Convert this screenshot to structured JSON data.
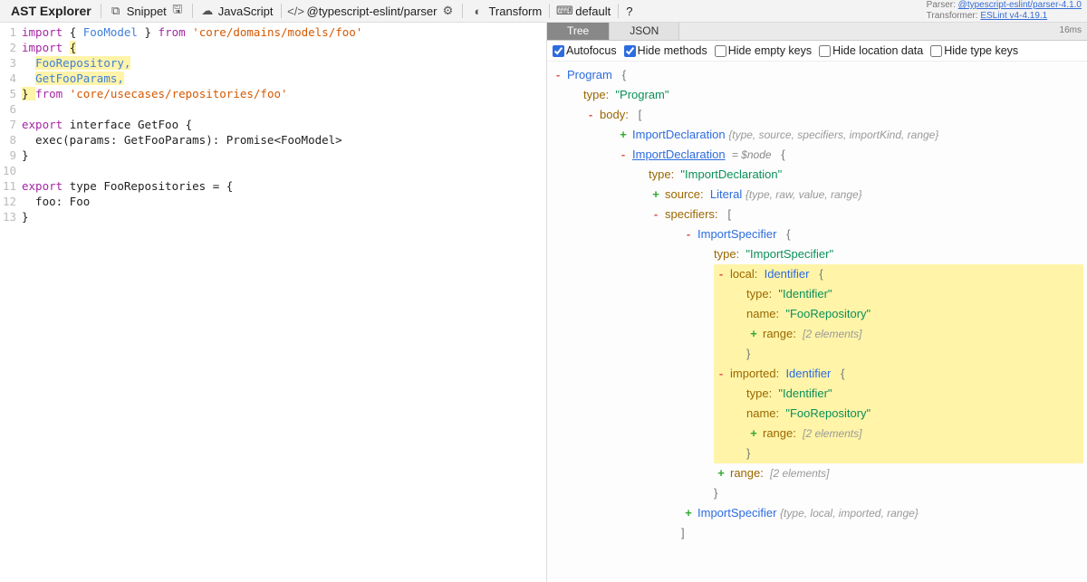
{
  "toolbar": {
    "brand": "AST Explorer",
    "snippet": "Snippet",
    "language": "JavaScript",
    "parser": "@typescript-eslint/parser",
    "transform": "Transform",
    "default": "default",
    "help": "?"
  },
  "parser_info": {
    "parser_label": "Parser:",
    "parser_link": "@typescript-eslint/parser-4.1.0",
    "transformer_label": "Transformer:",
    "transformer_link": "ESLint v4-4.19.1"
  },
  "code_lines": [
    {
      "n": "1",
      "segs": [
        {
          "t": "import ",
          "c": "k-import"
        },
        {
          "t": "{ "
        },
        {
          "t": "FooModel",
          "c": "k-type"
        },
        {
          "t": " } "
        },
        {
          "t": "from ",
          "c": "k-import"
        },
        {
          "t": "'core/domains/models/foo'",
          "c": "k-str"
        }
      ]
    },
    {
      "n": "2",
      "segs": [
        {
          "t": "import ",
          "c": "k-import"
        },
        {
          "t": "{",
          "hl": true
        }
      ]
    },
    {
      "n": "3",
      "segs": [
        {
          "t": "  "
        },
        {
          "t": "FooRepository,",
          "c": "k-type",
          "hl": true
        }
      ]
    },
    {
      "n": "4",
      "segs": [
        {
          "t": "  "
        },
        {
          "t": "GetFooParams,",
          "c": "k-type",
          "hl": true
        }
      ]
    },
    {
      "n": "5",
      "segs": [
        {
          "t": "} ",
          "hl": true
        },
        {
          "t": "from ",
          "c": "k-import"
        },
        {
          "t": "'core/usecases/repositories/foo'",
          "c": "k-str"
        }
      ]
    },
    {
      "n": "6",
      "segs": [
        {
          "t": ""
        }
      ]
    },
    {
      "n": "7",
      "segs": [
        {
          "t": "export ",
          "c": "k-export"
        },
        {
          "t": "interface ",
          "c": ""
        },
        {
          "t": "GetFoo "
        },
        {
          "t": "{"
        }
      ]
    },
    {
      "n": "8",
      "segs": [
        {
          "t": "  exec(params: GetFooParams): Promise<FooModel>"
        }
      ]
    },
    {
      "n": "9",
      "segs": [
        {
          "t": "}"
        }
      ]
    },
    {
      "n": "10",
      "segs": [
        {
          "t": ""
        }
      ]
    },
    {
      "n": "11",
      "segs": [
        {
          "t": "export ",
          "c": "k-export"
        },
        {
          "t": "type ",
          "c": ""
        },
        {
          "t": "FooRepositories = {"
        }
      ]
    },
    {
      "n": "12",
      "segs": [
        {
          "t": "  foo: Foo"
        }
      ]
    },
    {
      "n": "13",
      "segs": [
        {
          "t": "}"
        }
      ]
    }
  ],
  "tabs": {
    "tree": "Tree",
    "json": "JSON",
    "time": "16ms"
  },
  "opts": {
    "autofocus": "Autofocus",
    "hide_methods": "Hide methods",
    "hide_empty": "Hide empty keys",
    "hide_location": "Hide location data",
    "hide_type": "Hide type keys"
  },
  "tree": {
    "program": "Program",
    "type_key": "type:",
    "program_type": "\"Program\"",
    "body_key": "body:",
    "lbracket": "[",
    "rbracket": "]",
    "lbrace": "{",
    "rbrace": "}",
    "import_decl": "ImportDeclaration",
    "import_summary1": "{type, source, specifiers, importKind, range}",
    "node_annot": "= $node",
    "import_type_val": "\"ImportDeclaration\"",
    "source_key": "source:",
    "literal": "Literal",
    "literal_summary": "{type, raw, value, range}",
    "specifiers_key": "specifiers:",
    "import_spec": "ImportSpecifier",
    "import_spec_type": "\"ImportSpecifier\"",
    "local_key": "local:",
    "identifier": "Identifier",
    "identifier_type": "\"Identifier\"",
    "name_key": "name:",
    "name_val": "\"FooRepository\"",
    "range_key": "range:",
    "range_summary": "[2 elements]",
    "imported_key": "imported:",
    "import_spec_summary": "{type, local, imported, range}"
  }
}
